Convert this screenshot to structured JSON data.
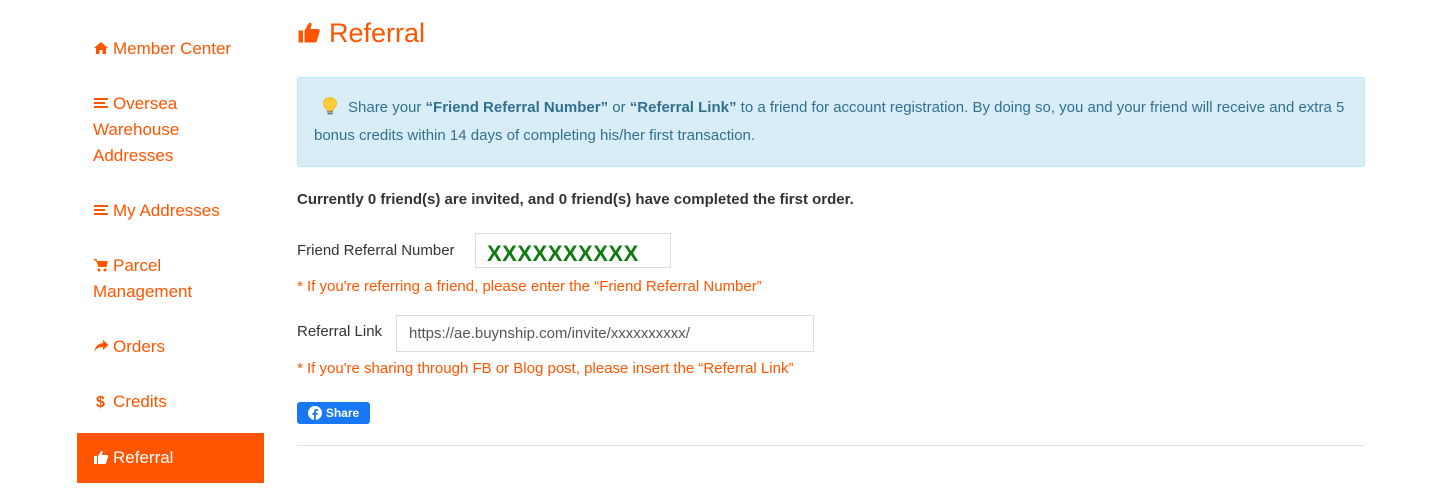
{
  "sidebar": {
    "items": [
      {
        "label": "Member Center",
        "icon": "home-icon"
      },
      {
        "label": "Oversea Warehouse Addresses",
        "icon": "list-icon"
      },
      {
        "label": "My Addresses",
        "icon": "list-icon"
      },
      {
        "label": "Parcel Management",
        "icon": "cart-icon"
      },
      {
        "label": "Orders",
        "icon": "share-arrow-icon"
      },
      {
        "label": "Credits",
        "icon": "dollar-icon"
      },
      {
        "label": "Referral",
        "icon": "thumbs-up-icon",
        "active": true
      }
    ]
  },
  "main": {
    "title": "Referral",
    "alert": {
      "prefix": "Share your ",
      "friend_number_term": "“Friend Referral Number”",
      "or": " or ",
      "referral_link_term": "“Referral Link”",
      "suffix": " to a friend for account registration. By doing so, you and your friend will receive and extra 5 bonus credits within 14 days of completing his/her first transaction."
    },
    "stats": "Currently 0 friend(s) are invited, and 0 friend(s) have completed the first order.",
    "referral_number": {
      "label": "Friend Referral Number",
      "value": "XXXXXXXXXX",
      "hint": "* If you're referring a friend, please enter the “Friend Referral Number”"
    },
    "referral_link": {
      "label": "Referral Link",
      "value": "https://ae.buynship.com/invite/xxxxxxxxxx/",
      "hint": "* If you're sharing through FB or Blog post, please insert the “Referral Link”"
    },
    "share_button": "Share"
  },
  "colors": {
    "accent": "#ff5500",
    "alert_bg": "#d9edf7",
    "alert_text": "#31708f",
    "referral_number_text": "#117a11",
    "facebook_blue": "#1877f2"
  }
}
